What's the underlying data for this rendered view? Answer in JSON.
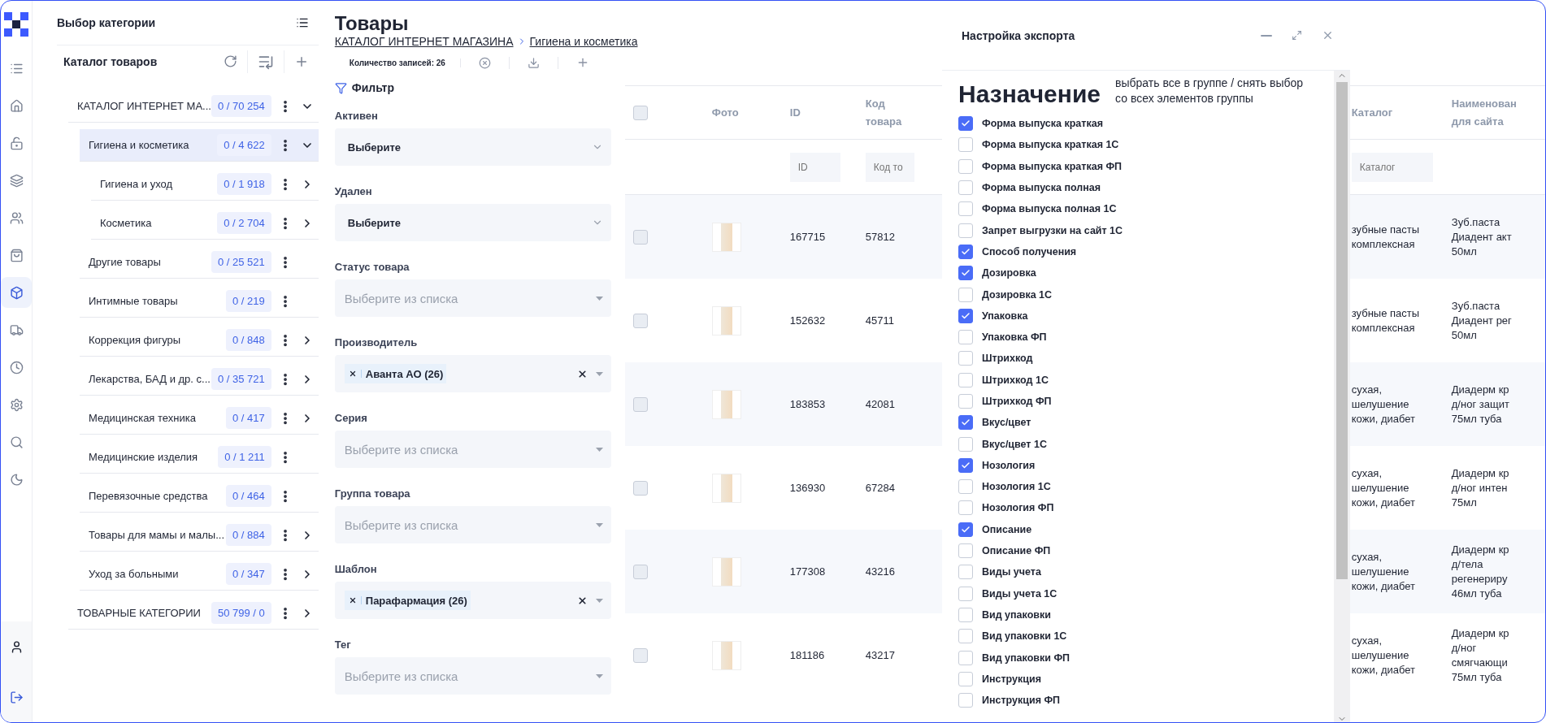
{
  "nav": {
    "items": [
      {
        "selected": false
      },
      {
        "selected": false
      },
      {
        "selected": false
      },
      {
        "selected": false
      },
      {
        "selected": false
      },
      {
        "selected": false
      },
      {
        "selected": true
      },
      {
        "selected": false
      },
      {
        "selected": false
      },
      {
        "selected": false
      },
      {
        "selected": false
      },
      {
        "selected": false
      }
    ]
  },
  "categories": {
    "title": "Выбор категории",
    "subtitle": "Каталог товаров",
    "tree": [
      {
        "label": "КАТАЛОГ ИНТЕРНЕТ МА...",
        "count": "0 / 70 254",
        "expandable": true,
        "expanded": true,
        "selected": false,
        "children": [
          {
            "label": "Гигиена и косметика",
            "count": "0 / 4 622",
            "expandable": true,
            "expanded": true,
            "selected": true,
            "children": [
              {
                "label": "Гигиена и уход",
                "count": "0 / 1 918",
                "expandable": true,
                "expanded": false,
                "selected": false
              },
              {
                "label": "Косметика",
                "count": "0 / 2 704",
                "expandable": true,
                "expanded": false,
                "selected": false
              }
            ]
          },
          {
            "label": "Другие товары",
            "count": "0 / 25 521",
            "expandable": false,
            "selected": false
          },
          {
            "label": "Интимные товары",
            "count": "0 / 219",
            "expandable": false,
            "selected": false
          },
          {
            "label": "Коррекция фигуры",
            "count": "0 / 848",
            "expandable": true,
            "expanded": false,
            "selected": false
          },
          {
            "label": "Лекарства, БАД и др. с...",
            "count": "0 / 35 721",
            "expandable": true,
            "expanded": false,
            "selected": false
          },
          {
            "label": "Медицинская техника",
            "count": "0 / 417",
            "expandable": true,
            "expanded": false,
            "selected": false
          },
          {
            "label": "Медицинские изделия",
            "count": "0 / 1 211",
            "expandable": false,
            "selected": false
          },
          {
            "label": "Перевязочные средства",
            "count": "0 / 464",
            "expandable": false,
            "selected": false
          },
          {
            "label": "Товары для мамы и малы...",
            "count": "0 / 884",
            "expandable": true,
            "expanded": false,
            "selected": false
          },
          {
            "label": "Уход за больными",
            "count": "0 / 347",
            "expandable": true,
            "expanded": false,
            "selected": false
          }
        ]
      },
      {
        "label": "ТОВАРНЫЕ КАТЕГОРИИ",
        "count": "50 799 / 0",
        "expandable": true,
        "expanded": false,
        "selected": false
      }
    ]
  },
  "products": {
    "title": "Товары",
    "breadcrumb": [
      "КАТАЛОГ ИНТЕРНЕТ МАГАЗИНА",
      "Гигиена и косметика"
    ],
    "records": "Количество записей: 26",
    "filter": {
      "title": "Фильтр",
      "fields": [
        {
          "kind": "select",
          "label": "Активен",
          "value": "Выберите"
        },
        {
          "kind": "select",
          "label": "Удален",
          "value": "Выберите"
        },
        {
          "kind": "multi",
          "label": "Статус товара",
          "placeholder": "Выберите из списка"
        },
        {
          "kind": "multi",
          "label": "Производитель",
          "tags": [
            "Аванта АО (26)"
          ]
        },
        {
          "kind": "multi",
          "label": "Серия",
          "placeholder": "Выберите из списка"
        },
        {
          "kind": "multi",
          "label": "Группа товара",
          "placeholder": "Выберите из списка"
        },
        {
          "kind": "multi",
          "label": "Шаблон",
          "tags": [
            "Парафармация (26)"
          ]
        },
        {
          "kind": "multi",
          "label": "Тег",
          "placeholder": "Выберите из списка"
        }
      ]
    },
    "table": {
      "header_checked": false,
      "columns": [
        "Фото",
        "ID",
        "Код товара",
        "Каталог",
        "Наименован для сайта"
      ],
      "filters": [
        {
          "placeholder": "ID"
        },
        {
          "placeholder": "Код то"
        },
        {
          "placeholder": "Каталог"
        }
      ],
      "rows": [
        {
          "checked": false,
          "id": "167715",
          "code": "57812",
          "catalog": "зубные пасты комплексная",
          "name": [
            "Зуб.паста",
            "Диадент акт",
            "50мл"
          ]
        },
        {
          "checked": false,
          "id": "152632",
          "code": "45711",
          "catalog": "зубные пасты комплексная",
          "name": [
            "Зуб.паста",
            "Диадент рег",
            "50мл"
          ]
        },
        {
          "checked": false,
          "id": "183853",
          "code": "42081",
          "catalog": "сухая, шелушение кожи, диабет",
          "name": [
            "Диадерм кр",
            "д/ног защит",
            "75мл туба"
          ]
        },
        {
          "checked": false,
          "id": "136930",
          "code": "67284",
          "catalog": "сухая, шелушение кожи, диабет",
          "name": [
            "Диадерм кр",
            "д/ног интен",
            "75мл"
          ]
        },
        {
          "checked": false,
          "id": "177308",
          "code": "43216",
          "catalog": "сухая, шелушение кожи, диабет",
          "name": [
            "Диадерм кр",
            "д/тела",
            "регенериру",
            "46мл туба"
          ]
        },
        {
          "checked": false,
          "id": "181186",
          "code": "43217",
          "catalog": "сухая, шелушение кожи, диабет",
          "name": [
            "Диадерм кр",
            "д/ног",
            "смягчающи",
            "75мл туба"
          ]
        }
      ]
    }
  },
  "export": {
    "title": "Настройка экспорта",
    "group": "Назначение",
    "hint": "выбрать все в группе / снять выбор со всех элементов группы",
    "items": [
      {
        "label": "Форма выпуска краткая",
        "checked": true
      },
      {
        "label": "Форма выпуска краткая 1С",
        "checked": false
      },
      {
        "label": "Форма выпуска краткая ФП",
        "checked": false
      },
      {
        "label": "Форма выпуска полная",
        "checked": false
      },
      {
        "label": "Форма выпуска полная 1С",
        "checked": false
      },
      {
        "label": "Запрет выгрузки на сайт 1С",
        "checked": false
      },
      {
        "label": "Способ получения",
        "checked": true
      },
      {
        "label": "Дозировка",
        "checked": true
      },
      {
        "label": "Дозировка 1С",
        "checked": false
      },
      {
        "label": "Упаковка",
        "checked": true
      },
      {
        "label": "Упаковка ФП",
        "checked": false
      },
      {
        "label": "Штрихкод",
        "checked": false
      },
      {
        "label": "Штрихкод 1С",
        "checked": false
      },
      {
        "label": "Штрихкод ФП",
        "checked": false
      },
      {
        "label": "Вкус/цвет",
        "checked": true
      },
      {
        "label": "Вкус/цвет 1С",
        "checked": false
      },
      {
        "label": "Нозология",
        "checked": true
      },
      {
        "label": "Нозология 1С",
        "checked": false
      },
      {
        "label": "Нозология ФП",
        "checked": false
      },
      {
        "label": "Описание",
        "checked": true
      },
      {
        "label": "Описание ФП",
        "checked": false
      },
      {
        "label": "Виды учета",
        "checked": false
      },
      {
        "label": "Виды учета 1С",
        "checked": false
      },
      {
        "label": "Вид упаковки",
        "checked": false
      },
      {
        "label": "Вид упаковки 1С",
        "checked": false
      },
      {
        "label": "Вид упаковки ФП",
        "checked": false
      },
      {
        "label": "Инструкция",
        "checked": false
      },
      {
        "label": "Инструкция ФП",
        "checked": false
      }
    ]
  }
}
